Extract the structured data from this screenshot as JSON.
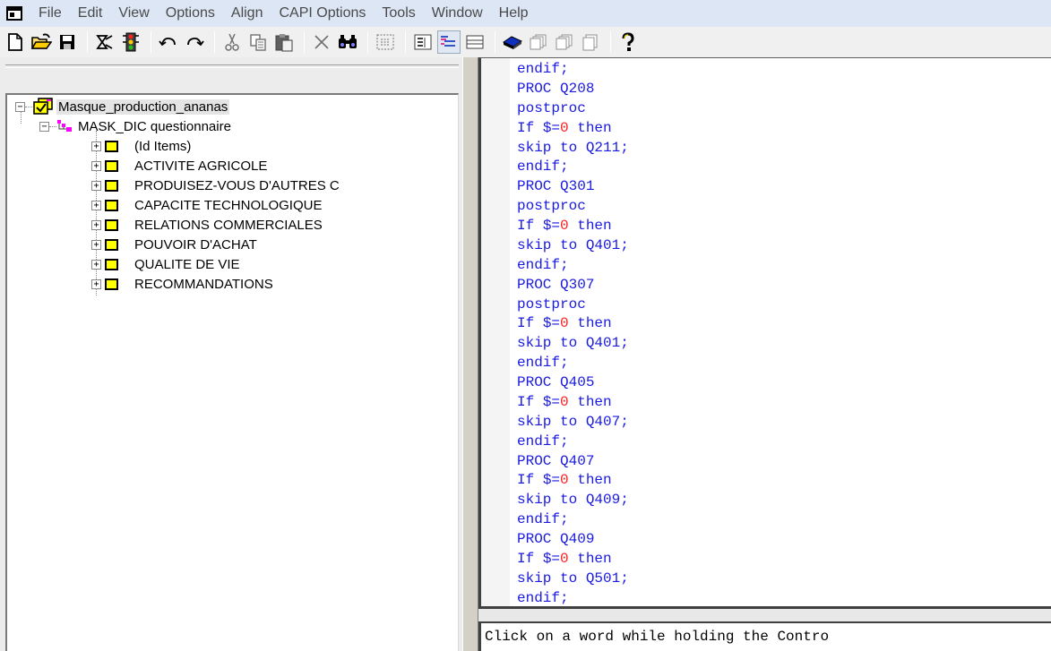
{
  "menubar": {
    "items": [
      "File",
      "Edit",
      "View",
      "Options",
      "Align",
      "CAPI Options",
      "Tools",
      "Window",
      "Help"
    ]
  },
  "toolbar": {
    "buttons": [
      "new-icon",
      "open-icon",
      "save-icon",
      "compile-icon",
      "run-icon",
      "undo-icon",
      "redo-icon",
      "cut-icon",
      "copy-icon",
      "paste-icon",
      "delete-icon",
      "find-icon",
      "view-form-icon",
      "view-logic-icon",
      "view-tree-icon",
      "view-list-icon",
      "dictionary-icon",
      "forms-icon",
      "batch-icon",
      "tabs-icon",
      "help-icon"
    ]
  },
  "tree": {
    "root": "Masque_production_ananas",
    "dictionary": "MASK_DIC questionnaire",
    "items": [
      "(Id Items)",
      "ACTIVITE AGRICOLE",
      "PRODUISEZ-VOUS D'AUTRES C",
      "CAPACITE TECHNOLOGIQUE",
      "RELATIONS COMMERCIALES",
      "POUVOIR D'ACHAT",
      "QUALITE DE VIE",
      "RECOMMANDATIONS"
    ]
  },
  "code": {
    "lines": [
      "endif;",
      "PROC Q208",
      "postproc",
      "If $=0 then",
      "skip to Q211;",
      "endif;",
      "PROC Q301",
      "postproc",
      "If $=0 then",
      "skip to Q401;",
      "endif;",
      "PROC Q307",
      "postproc",
      "If $=0 then",
      "skip to Q401;",
      "endif;",
      "PROC Q405",
      "If $=0 then",
      "skip to Q407;",
      "endif;",
      "PROC Q407",
      "If $=0 then",
      "skip to Q409;",
      "endif;",
      "PROC Q409",
      "If $=0 then",
      "skip to Q501;",
      "endif;"
    ],
    "keyword_color": "#1a1ae0",
    "number_color": "#ff2020"
  },
  "output": {
    "text": "Click on a word while holding the Contro"
  },
  "colors": {
    "menubar_bg": "#dce6f4",
    "tree_folder": "#ffff00"
  }
}
